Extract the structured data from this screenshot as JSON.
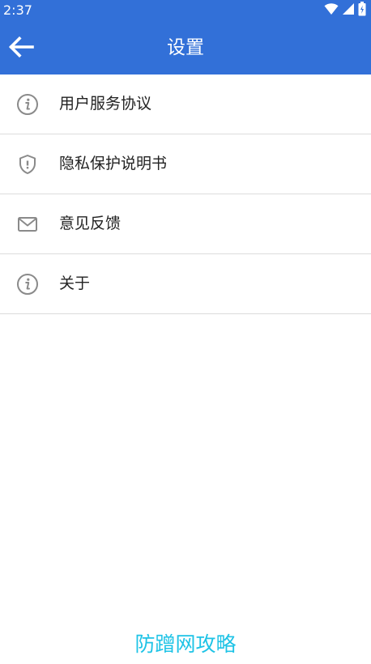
{
  "status_bar": {
    "time": "2:37",
    "icons": [
      "wifi-icon",
      "signal-icon",
      "battery-icon"
    ]
  },
  "app_bar": {
    "title": "设置",
    "back_icon": "arrow-left-icon"
  },
  "menu": {
    "items": [
      {
        "label": "用户服务协议",
        "icon": "info-circle-icon"
      },
      {
        "label": "隐私保护说明书",
        "icon": "shield-icon"
      },
      {
        "label": "意见反馈",
        "icon": "mail-icon"
      },
      {
        "label": "关于",
        "icon": "info-circle-icon"
      }
    ]
  },
  "footer": {
    "text": "防蹭网攻略"
  },
  "colors": {
    "primary": "#3270d8",
    "icon_gray": "#8a8a8a",
    "divider": "#dcdcdc",
    "footer_text": "#1ec3e6"
  }
}
